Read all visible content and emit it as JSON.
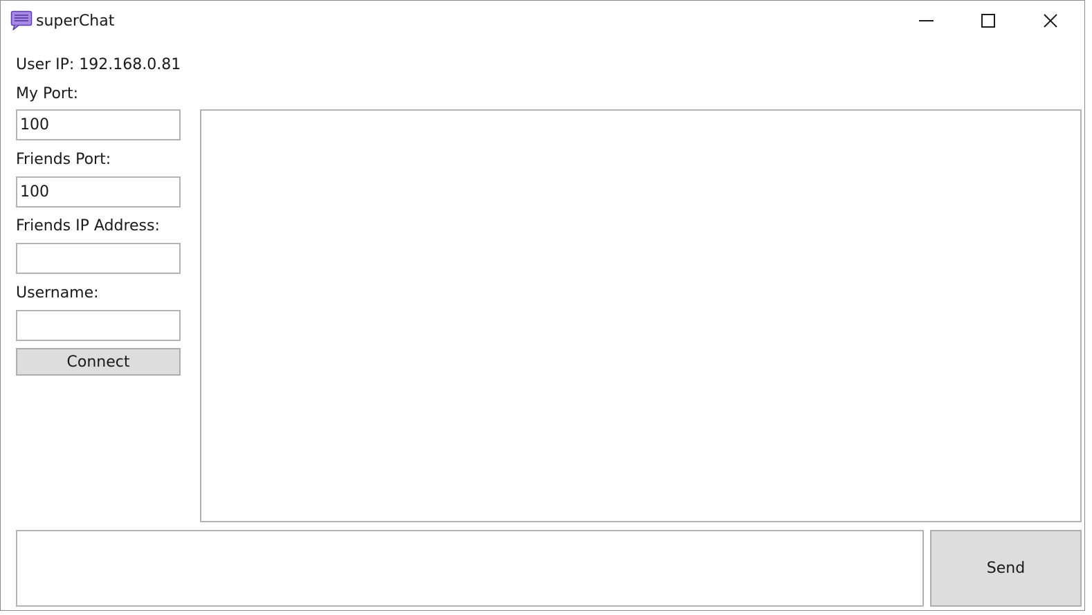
{
  "window": {
    "title": "superChat",
    "app_icon": "chat-bubble-icon",
    "accent_color": "#8f6bdc",
    "controls": [
      "minimize-icon",
      "maximize-icon",
      "close-icon"
    ]
  },
  "connection": {
    "user_ip_label": "User IP: 192.168.0.81",
    "my_port_label": "My Port:",
    "my_port_value": "100",
    "friends_port_label": "Friends Port:",
    "friends_port_value": "100",
    "friends_ip_label": "Friends IP Address:",
    "friends_ip_value": "",
    "username_label": "Username:",
    "username_value": "",
    "connect_label": "Connect"
  },
  "chat": {
    "messages": [],
    "message_value": "",
    "send_label": "Send"
  }
}
